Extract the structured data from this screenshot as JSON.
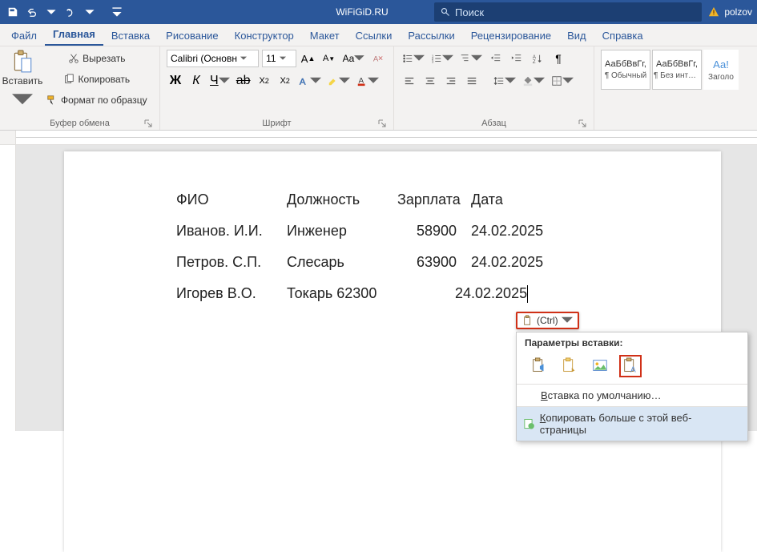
{
  "titlebar": {
    "doc_title": "WiFiGiD.RU",
    "search_placeholder": "Поиск",
    "user": "polzov"
  },
  "tabs": [
    "Файл",
    "Главная",
    "Вставка",
    "Рисование",
    "Конструктор",
    "Макет",
    "Ссылки",
    "Рассылки",
    "Рецензирование",
    "Вид",
    "Справка"
  ],
  "active_tab_index": 1,
  "ribbon": {
    "clipboard": {
      "paste": "Вставить",
      "cut": "Вырезать",
      "copy": "Копировать",
      "format_painter": "Формат по образцу",
      "group_title": "Буфер обмена"
    },
    "font": {
      "font_name": "Calibri (Основн",
      "font_size": "11",
      "group_title": "Шрифт",
      "bold": "Ж",
      "italic": "К",
      "underline": "Ч",
      "strike": "ab"
    },
    "paragraph": {
      "group_title": "Абзац"
    },
    "styles": {
      "preview": "АаБбВвГг,",
      "s1": "¶ Обычный",
      "s2": "¶ Без инте…",
      "s3": "Заголо"
    }
  },
  "document": {
    "header": {
      "c1": "ФИО",
      "c2": "Должность",
      "c3": "Зарплата",
      "c4": "Дата"
    },
    "rows": [
      {
        "c1": "Иванов. И.И.",
        "c2": "Инженер",
        "c3": "58900",
        "c4": "24.02.2025"
      },
      {
        "c1": "Петров. С.П.",
        "c2": "Слесарь",
        "c3": "63900",
        "c4": "24.02.2025"
      },
      {
        "c1": "Игорев В.О.",
        "c2": "Токарь 62300",
        "c3": "",
        "c4": "24.02.2025"
      }
    ]
  },
  "paste_popup": {
    "badge_label": "(Ctrl)",
    "title": "Параметры вставки:",
    "default_text": "Вставка по умолчанию…",
    "copy_more": "Копировать больше с этой веб-страницы"
  }
}
